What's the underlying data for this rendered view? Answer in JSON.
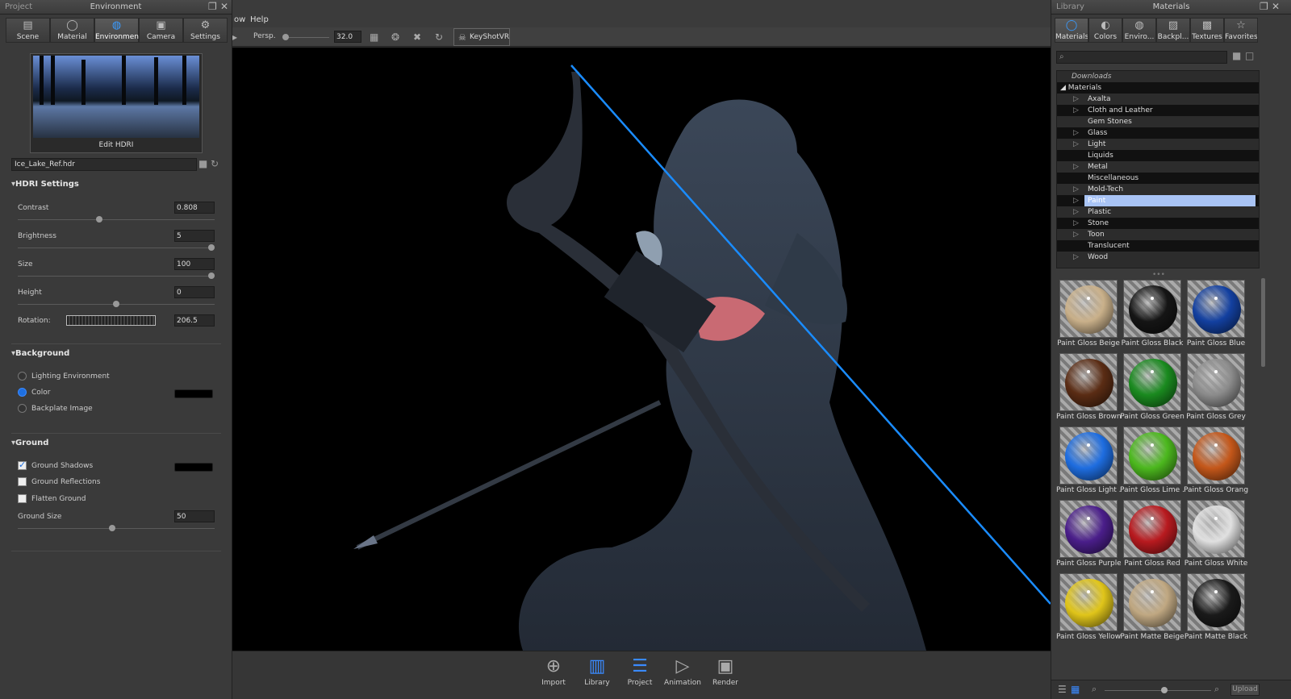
{
  "left_panel": {
    "project_label": "Project",
    "title": "Environment",
    "tabs": [
      {
        "label": "Scene",
        "icon": "scene-icon"
      },
      {
        "label": "Material",
        "icon": "material-icon"
      },
      {
        "label": "Environment",
        "icon": "environment-icon"
      },
      {
        "label": "Camera",
        "icon": "camera-icon"
      },
      {
        "label": "Settings",
        "icon": "settings-icon"
      }
    ],
    "active_tab": "Environment",
    "edit_hdri_label": "Edit HDRI",
    "hdri_file": "Ice_Lake_Ref.hdr",
    "hdri_settings": {
      "header": "HDRI Settings",
      "contrast": {
        "label": "Contrast",
        "value": "0.808",
        "level": 0.41
      },
      "brightness": {
        "label": "Brightness",
        "value": "5",
        "level": 1.0
      },
      "size": {
        "label": "Size",
        "value": "100",
        "level": 1.0
      },
      "height": {
        "label": "Height",
        "value": "0",
        "level": 0.5
      },
      "rotation": {
        "label": "Rotation:",
        "value": "206.5"
      }
    },
    "background": {
      "header": "Background",
      "options": [
        "Lighting Environment",
        "Color",
        "Backplate Image"
      ],
      "selected": "Color",
      "color": "#000000"
    },
    "ground": {
      "header": "Ground",
      "shadows": {
        "label": "Ground Shadows",
        "checked": true,
        "color": "#000000"
      },
      "reflections": {
        "label": "Ground Reflections",
        "checked": false
      },
      "flatten": {
        "label": "Flatten Ground",
        "checked": false
      },
      "size": {
        "label": "Ground Size",
        "value": "50",
        "level": 0.48
      }
    }
  },
  "center": {
    "menu": [
      "ow",
      "Help"
    ],
    "camera_mode": "Persp.",
    "fov": "32.0",
    "keyshotvr_label": "KeyShotVR",
    "dock": [
      {
        "label": "Import",
        "icon": "import-icon"
      },
      {
        "label": "Library",
        "icon": "library-icon"
      },
      {
        "label": "Project",
        "icon": "project-icon"
      },
      {
        "label": "Animation",
        "icon": "animation-icon"
      },
      {
        "label": "Render",
        "icon": "render-icon"
      }
    ],
    "accent": "#1a8cff"
  },
  "right_panel": {
    "library_label": "Library",
    "title": "Materials",
    "tabs": [
      {
        "label": "Materials",
        "icon": "materials-icon"
      },
      {
        "label": "Colors",
        "icon": "colors-icon"
      },
      {
        "label": "Enviro...",
        "icon": "environments-icon"
      },
      {
        "label": "Backpl...",
        "icon": "backplates-icon"
      },
      {
        "label": "Textures",
        "icon": "textures-icon"
      },
      {
        "label": "Favorites",
        "icon": "favorites-icon"
      }
    ],
    "tree": {
      "downloads": "Downloads",
      "root": "Materials",
      "items": [
        {
          "label": "Axalta",
          "expandable": true
        },
        {
          "label": "Cloth and Leather",
          "expandable": true
        },
        {
          "label": "Gem Stones",
          "expandable": false
        },
        {
          "label": "Glass",
          "expandable": true
        },
        {
          "label": "Light",
          "expandable": true
        },
        {
          "label": "Liquids",
          "expandable": false
        },
        {
          "label": "Metal",
          "expandable": true
        },
        {
          "label": "Miscellaneous",
          "expandable": false
        },
        {
          "label": "Mold-Tech",
          "expandable": true
        },
        {
          "label": "Paint",
          "expandable": true,
          "selected": true
        },
        {
          "label": "Plastic",
          "expandable": true
        },
        {
          "label": "Stone",
          "expandable": true
        },
        {
          "label": "Toon",
          "expandable": true
        },
        {
          "label": "Translucent",
          "expandable": false
        },
        {
          "label": "Wood",
          "expandable": true
        }
      ]
    },
    "materials": [
      {
        "label": "Paint Gloss Beige",
        "color": "#c9b08a"
      },
      {
        "label": "Paint Gloss Black",
        "color": "#151515"
      },
      {
        "label": "Paint Gloss Blue",
        "color": "#1340a0"
      },
      {
        "label": "Paint Gloss Brown",
        "color": "#5a2c14"
      },
      {
        "label": "Paint Gloss Green",
        "color": "#1a8a1f"
      },
      {
        "label": "Paint Gloss Grey",
        "color": "#8c8c8c"
      },
      {
        "label": "Paint Gloss Light ...",
        "color": "#1e6de0"
      },
      {
        "label": "Paint Gloss Lime ...",
        "color": "#4cb81e"
      },
      {
        "label": "Paint Gloss Orange",
        "color": "#c4571a"
      },
      {
        "label": "Paint Gloss Purple",
        "color": "#4a1e8a"
      },
      {
        "label": "Paint Gloss Red",
        "color": "#b81a1f"
      },
      {
        "label": "Paint Gloss White",
        "color": "#e0e0e0"
      },
      {
        "label": "Paint Gloss Yellow",
        "color": "#e0c51a"
      },
      {
        "label": "Paint Matte Beige",
        "color": "#c0a882"
      },
      {
        "label": "Paint Matte Black",
        "color": "#1a1a1a"
      }
    ],
    "upload_label": "Upload"
  }
}
